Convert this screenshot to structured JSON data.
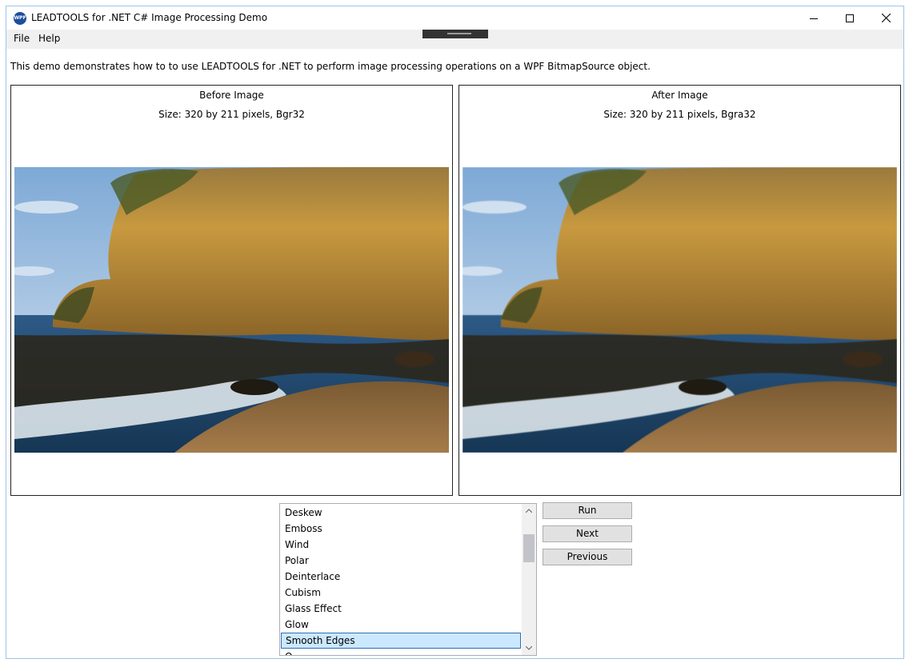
{
  "window": {
    "title": "LEADTOOLS for .NET C# Image Processing Demo",
    "icon_label": "WPF"
  },
  "menu": {
    "file": "File",
    "help": "Help"
  },
  "description": "This demo demonstrates how to to use LEADTOOLS for .NET to perform image processing operations on a WPF BitmapSource object.",
  "before": {
    "title": "Before Image",
    "size": "Size: 320 by 211 pixels, Bgr32"
  },
  "after": {
    "title": "After Image",
    "size": "Size: 320 by 211 pixels, Bgra32"
  },
  "operations": {
    "items": [
      "Deskew",
      "Emboss",
      "Wind",
      "Polar",
      "Deinterlace",
      "Cubism",
      "Glass Effect",
      "Glow",
      "Smooth Edges",
      "O..."
    ],
    "selected": "Smooth Edges"
  },
  "buttons": {
    "run": "Run",
    "next": "Next",
    "previous": "Previous"
  },
  "colors": {
    "selection": "#cce8ff",
    "selection_border": "#2f6fb0",
    "window_border": "#a0c4e8"
  }
}
